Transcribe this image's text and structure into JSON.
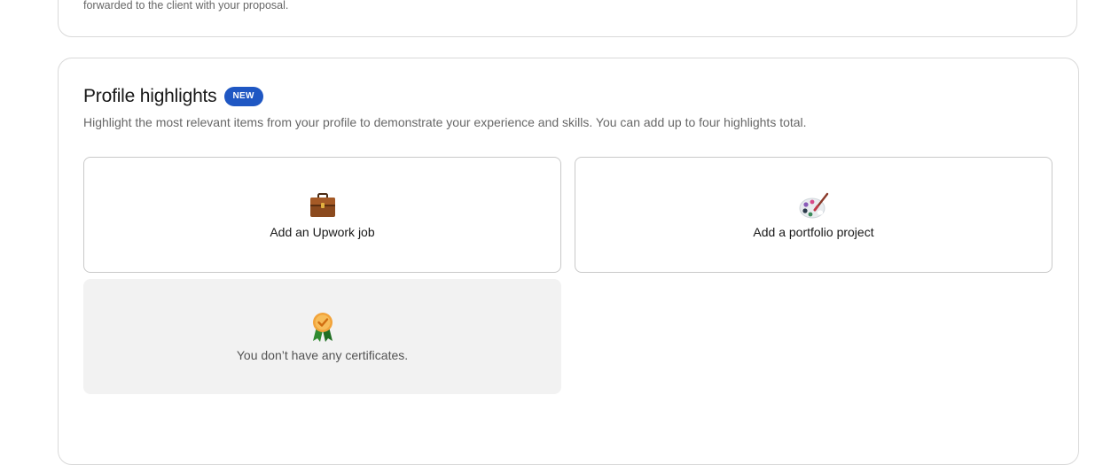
{
  "top_card": {
    "note": "forwarded to the client with your proposal."
  },
  "highlights": {
    "title": "Profile highlights",
    "badge": "NEW",
    "description": "Highlight the most relevant items from your profile to demonstrate your experience and skills. You can add up to four highlights total.",
    "tiles": [
      {
        "label": "Add an Upwork job",
        "icon": "briefcase-icon"
      },
      {
        "label": "Add a portfolio project",
        "icon": "palette-icon"
      },
      {
        "label": "You don’t have any certificates.",
        "icon": "certificate-ribbon-icon"
      }
    ]
  },
  "colors": {
    "badge_bg": "#1f57c3",
    "border": "#d9d9d9",
    "disabled_tile_bg": "#f2f2f2"
  }
}
